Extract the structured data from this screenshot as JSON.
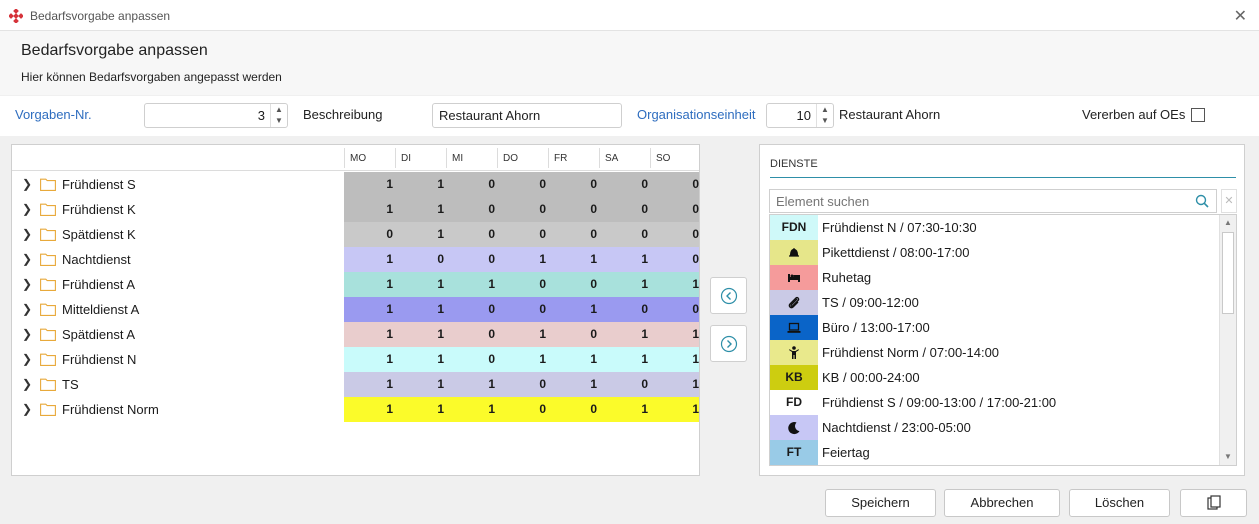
{
  "window": {
    "title": "Bedarfsvorgabe anpassen"
  },
  "header": {
    "title": "Bedarfsvorgabe anpassen",
    "subtitle": "Hier können Bedarfsvorgaben angepasst werden"
  },
  "form": {
    "vorgaben_label": "Vorgaben-Nr.",
    "vorgaben_value": "3",
    "beschreibung_label": "Beschreibung",
    "beschreibung_value": "Restaurant Ahorn",
    "oe_label": "Organisationseinheit",
    "oe_value": "10",
    "oe_name": "Restaurant Ahorn",
    "vererben_label": "Vererben auf OEs"
  },
  "grid": {
    "days": [
      "MO",
      "DI",
      "MI",
      "DO",
      "FR",
      "SA",
      "SO"
    ],
    "rows": [
      {
        "name": "Frühdienst S",
        "color": "#bdbdbd",
        "values": [
          "1",
          "1",
          "0",
          "0",
          "0",
          "0",
          "0"
        ]
      },
      {
        "name": "Frühdienst K",
        "color": "#bdbdbd",
        "values": [
          "1",
          "1",
          "0",
          "0",
          "0",
          "0",
          "0"
        ]
      },
      {
        "name": "Spätdienst K",
        "color": "#c9c9c9",
        "values": [
          "0",
          "1",
          "0",
          "0",
          "0",
          "0",
          "0"
        ]
      },
      {
        "name": "Nachtdienst",
        "color": "#c7c7f5",
        "values": [
          "1",
          "0",
          "0",
          "1",
          "1",
          "1",
          "0"
        ]
      },
      {
        "name": "Frühdienst A",
        "color": "#a8e1dc",
        "values": [
          "1",
          "1",
          "1",
          "0",
          "0",
          "1",
          "1"
        ]
      },
      {
        "name": "Mitteldienst A",
        "color": "#9a9af0",
        "values": [
          "1",
          "1",
          "0",
          "0",
          "1",
          "0",
          "0"
        ]
      },
      {
        "name": "Spätdienst A",
        "color": "#e9cdcd",
        "values": [
          "1",
          "1",
          "0",
          "1",
          "0",
          "1",
          "1"
        ]
      },
      {
        "name": "Frühdienst N",
        "color": "#c9fbfb",
        "values": [
          "1",
          "1",
          "0",
          "1",
          "1",
          "1",
          "1"
        ]
      },
      {
        "name": "TS",
        "color": "#cacae6",
        "values": [
          "1",
          "1",
          "1",
          "0",
          "1",
          "0",
          "1"
        ]
      },
      {
        "name": "Frühdienst Norm",
        "color": "#fbfb2a",
        "values": [
          "1",
          "1",
          "1",
          "0",
          "0",
          "1",
          "1"
        ]
      }
    ]
  },
  "dienste": {
    "title": "DIENSTE",
    "search_placeholder": "Element suchen",
    "items": [
      {
        "code": "FDN",
        "icon": "",
        "color": "#cff9f9",
        "label": "Frühdienst N / 07:30-10:30"
      },
      {
        "code": "",
        "icon": "bell-icon",
        "color": "#e6e68a",
        "label": "Pikettdienst / 08:00-17:00"
      },
      {
        "code": "",
        "icon": "bed-icon",
        "color": "#f59b9b",
        "label": "Ruhetag"
      },
      {
        "code": "",
        "icon": "paperclip-icon",
        "color": "#cacae6",
        "label": "TS / 09:00-12:00"
      },
      {
        "code": "",
        "icon": "laptop-icon",
        "color": "#0a64c8",
        "label": "Büro / 13:00-17:00"
      },
      {
        "code": "",
        "icon": "person-icon",
        "color": "#e9e98c",
        "label": "Frühdienst Norm / 07:00-14:00"
      },
      {
        "code": "KB",
        "icon": "",
        "color": "#cdcd10",
        "label": "KB / 00:00-24:00"
      },
      {
        "code": "FD",
        "icon": "",
        "color": "#ffffff",
        "label": "Frühdienst S / 09:00-13:00 / 17:00-21:00"
      },
      {
        "code": "",
        "icon": "moon-icon",
        "color": "#c7c7f5",
        "label": "Nachtdienst / 23:00-05:00"
      },
      {
        "code": "FT",
        "icon": "",
        "color": "#99cbe7",
        "label": "Feiertag"
      }
    ]
  },
  "buttons": {
    "save": "Speichern",
    "cancel": "Abbrechen",
    "delete": "Löschen"
  }
}
